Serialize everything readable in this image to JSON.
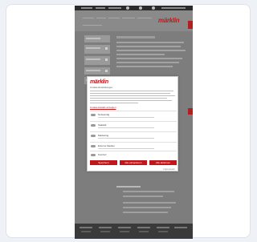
{
  "site": {
    "brand": "märklin"
  },
  "modal": {
    "brand": "märklin",
    "heading": "Cookie-Einstellungen",
    "details_link": "Cookie-Details anzeigen",
    "options": [
      {
        "label": "Notwendig"
      },
      {
        "label": "Statistik"
      },
      {
        "label": "Marketing"
      },
      {
        "label": "Externe Medien"
      },
      {
        "label": "Komfort"
      }
    ],
    "buttons": [
      {
        "label": "Speichern"
      },
      {
        "label": "Alle akzeptieren"
      },
      {
        "label": "Alle ablehnen"
      }
    ],
    "more_link": "Impressum"
  },
  "colors": {
    "brand_red": "#c0171c",
    "overlay_gray": "#7d7d7d",
    "footer": "#3a3a3a"
  }
}
